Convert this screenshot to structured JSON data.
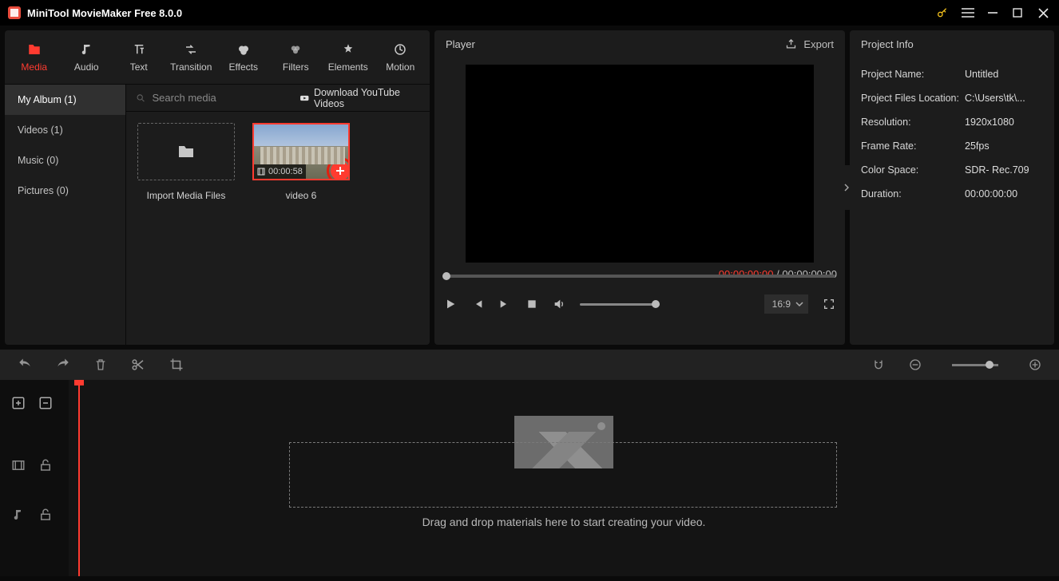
{
  "title": "MiniTool MovieMaker Free 8.0.0",
  "nav": [
    {
      "id": "media",
      "label": "Media"
    },
    {
      "id": "audio",
      "label": "Audio"
    },
    {
      "id": "text",
      "label": "Text"
    },
    {
      "id": "transition",
      "label": "Transition"
    },
    {
      "id": "effects",
      "label": "Effects"
    },
    {
      "id": "filters",
      "label": "Filters"
    },
    {
      "id": "elements",
      "label": "Elements"
    },
    {
      "id": "motion",
      "label": "Motion"
    }
  ],
  "sidebar": [
    {
      "label": "My Album (1)",
      "active": true
    },
    {
      "label": "Videos (1)"
    },
    {
      "label": "Music (0)"
    },
    {
      "label": "Pictures (0)"
    }
  ],
  "search_placeholder": "Search media",
  "download_videos_label": "Download YouTube Videos",
  "import_label": "Import Media Files",
  "clip": {
    "duration": "00:00:58",
    "name": "video 6"
  },
  "player": {
    "title": "Player",
    "export_label": "Export",
    "current": "00:00:00:00",
    "total": "00:00:00:00",
    "aspect": "16:9"
  },
  "project_info": {
    "title": "Project Info",
    "fields": [
      {
        "k": "Project Name:",
        "v": "Untitled"
      },
      {
        "k": "Project Files Location:",
        "v": "C:\\Users\\tk\\..."
      },
      {
        "k": "Resolution:",
        "v": "1920x1080"
      },
      {
        "k": "Frame Rate:",
        "v": "25fps"
      },
      {
        "k": "Color Space:",
        "v": "SDR- Rec.709"
      },
      {
        "k": "Duration:",
        "v": "00:00:00:00"
      }
    ]
  },
  "timeline_hint": "Drag and drop materials here to start creating your video."
}
